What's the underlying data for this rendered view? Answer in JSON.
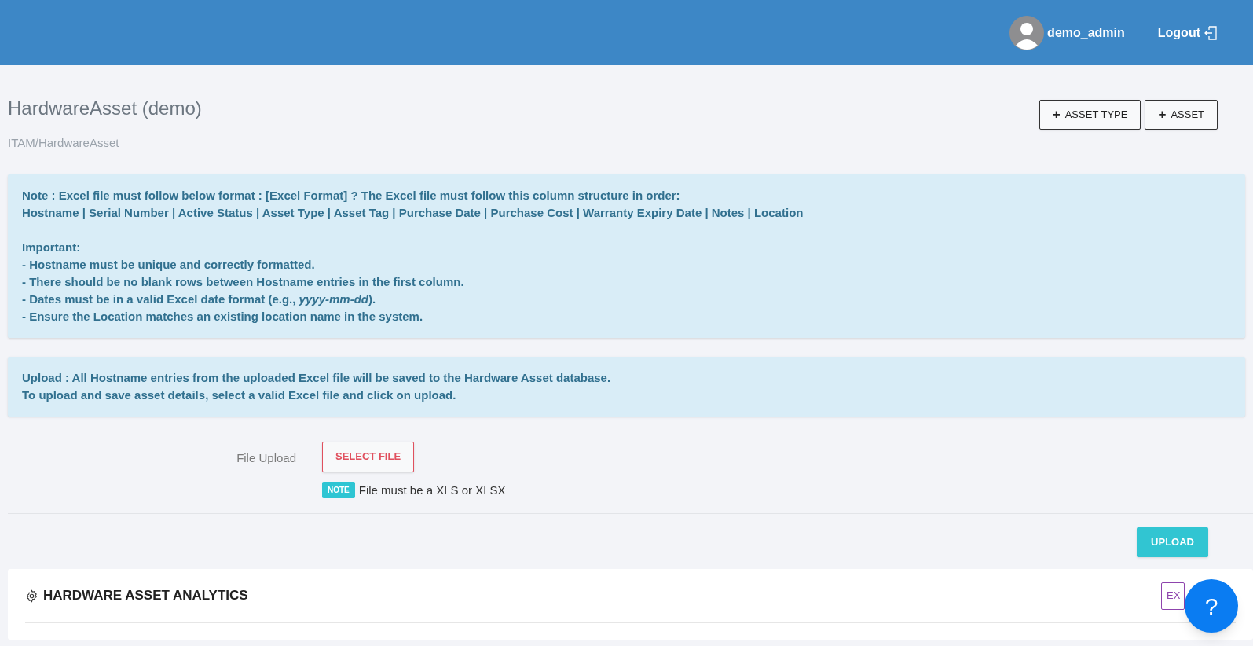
{
  "header": {
    "username": "demo_admin",
    "logout": "Logout"
  },
  "page": {
    "title": "HardwareAsset (demo)",
    "breadcrumb": "ITAM/HardwareAsset",
    "buttons": [
      {
        "label": "ASSET TYPE",
        "icon": "+"
      },
      {
        "label": "ASSET",
        "icon": "+"
      }
    ]
  },
  "note_box": {
    "lines": [
      "Note : Excel file must follow below format : [Excel Format] ? The Excel file must follow this column structure in order:",
      "Hostname | Serial Number | Active Status | Asset Type | Asset Tag | Purchase Date | Purchase Cost | Warranty Expiry Date | Notes | Location"
    ],
    "important_title": "Important:",
    "important_lines": [
      "- Hostname must be unique and correctly formatted.",
      "- There should be no blank rows between Hostname entries in the first column.",
      "- Dates must be in a valid Excel date format (e.g., *yyyy-mm-dd*).",
      "- Ensure the Location matches an existing location name in the system."
    ]
  },
  "upload_box": {
    "lines": [
      "Upload : All Hostname entries from the uploaded Excel file will be saved to the Hardware Asset database.",
      "To upload and save asset details, select a valid Excel file and click on upload."
    ]
  },
  "file_upload": {
    "label": "File Upload",
    "button": "SELECT FILE",
    "note_badge": "NOTE",
    "note_text": "File must be a XLS or XLSX"
  },
  "upload_button": "UPLOAD",
  "analytics": {
    "title": "HARDWARE ASSET ANALYTICS",
    "export_button": "EX"
  },
  "help_button": "?"
}
